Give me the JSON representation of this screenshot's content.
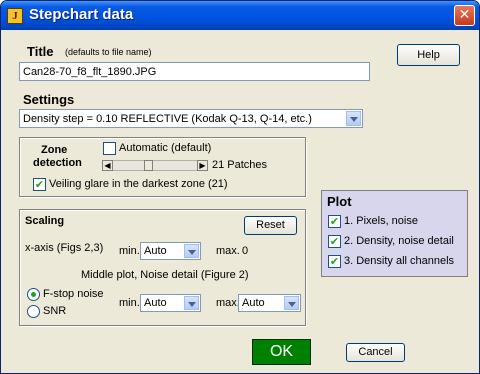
{
  "window": {
    "title": "Stepchart data",
    "app_icon_glyph": "J",
    "close_glyph": "✕"
  },
  "title_section": {
    "label": "Title",
    "hint": "(defaults to file name)",
    "value": "Can28-70_f8_flt_1890.JPG"
  },
  "help_button": "Help",
  "settings": {
    "label": "Settings",
    "selected": "Density step = 0.10  REFLECTIVE         (Kodak Q-13, Q-14, etc.)"
  },
  "zone_detection": {
    "label_line1": "Zone",
    "label_line2": "detection",
    "automatic_label": "Automatic (default)",
    "automatic_checked": false,
    "patches_label": "21 Patches",
    "veiling_label": "Veiling glare in the darkest zone (21)",
    "veiling_checked": true
  },
  "scaling": {
    "label": "Scaling",
    "reset_button": "Reset",
    "x_axis_label": "x-axis (Figs 2,3)",
    "min_label": "min.",
    "x_min": "Auto",
    "max_label": "max.",
    "x_max": "0",
    "middle_label": "Middle plot, Noise detail (Figure 2)",
    "fstop_label": "F-stop noise",
    "snr_label": "SNR",
    "fstop_selected": true,
    "min2_label": "min.",
    "y_min": "Auto",
    "max2_label": "max.",
    "y_max": "Auto"
  },
  "plot": {
    "label": "Plot",
    "items": [
      {
        "label": "1. Pixels, noise",
        "checked": true
      },
      {
        "label": "2. Density, noise detail",
        "checked": true
      },
      {
        "label": "3. Density all channels",
        "checked": true
      }
    ]
  },
  "ok_button": "OK",
  "cancel_button": "Cancel",
  "check_glyph": "✔",
  "colors": {
    "titlebar": "#0054e3",
    "dialog_bg": "#ece9d8",
    "plot_panel": "#d8d6ed",
    "ok_button": "#008000"
  }
}
